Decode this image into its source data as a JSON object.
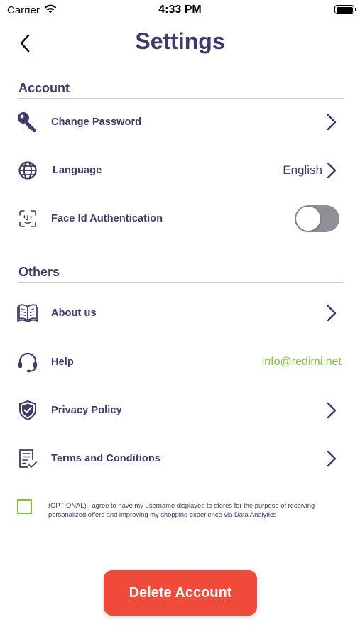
{
  "status_bar": {
    "carrier": "Carrier",
    "time": "4:33 PM"
  },
  "header": {
    "title": "Settings"
  },
  "sections": {
    "account": {
      "title": "Account",
      "items": [
        {
          "label": "Change Password",
          "icon": "key-icon"
        },
        {
          "label": "Language",
          "icon": "globe-icon",
          "value": "English"
        },
        {
          "label": "Face Id Authentication",
          "icon": "face-id-icon",
          "toggle": false
        }
      ]
    },
    "others": {
      "title": "Others",
      "items": [
        {
          "label": "About us",
          "icon": "book-icon"
        },
        {
          "label": "Help",
          "icon": "headset-icon",
          "value": "info@redimi.net"
        },
        {
          "label": "Privacy Policy",
          "icon": "shield-icon"
        },
        {
          "label": "Terms and Conditions",
          "icon": "document-icon"
        }
      ]
    }
  },
  "consent": {
    "checked": false,
    "text": "(OPTIONAL) I agree to have my username displayed to stores for the purpose of receiving personalized offers and improving my shopping experience via Data Analytics"
  },
  "delete_button": {
    "label": "Delete Account"
  },
  "colors": {
    "primary": "#3d3b6b",
    "accent_green": "#7cc33a",
    "danger": "#f04a3a",
    "toggle_off": "#8f8f95"
  }
}
